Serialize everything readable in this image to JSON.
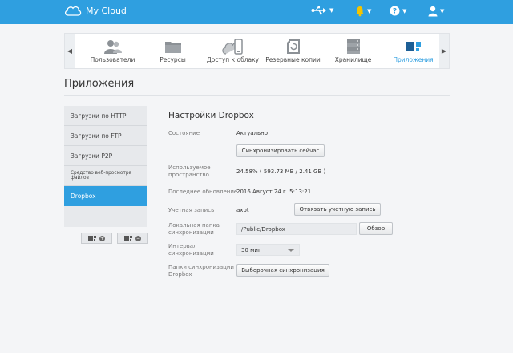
{
  "header": {
    "brand": "My Cloud"
  },
  "nav": {
    "items": [
      {
        "label": "Пользователи"
      },
      {
        "label": "Ресурсы"
      },
      {
        "label": "Доступ к облаку"
      },
      {
        "label": "Резервные копии"
      },
      {
        "label": "Хранилище"
      },
      {
        "label": "Приложения"
      }
    ],
    "active": "Приложения"
  },
  "page": {
    "title": "Приложения"
  },
  "sidebar": {
    "items": [
      {
        "label": "Загрузки по HTTP"
      },
      {
        "label": "Загрузки по FTP"
      },
      {
        "label": "Загрузки P2P"
      },
      {
        "label": "Средство веб-просмотра файлов"
      },
      {
        "label": "Dropbox"
      }
    ],
    "active": "Dropbox"
  },
  "dropbox": {
    "title": "Настройки Dropbox",
    "status_label": "Состояние",
    "status_value": "Актуально",
    "sync_now_button": "Синхронизировать сейчас",
    "used_space_label_1": "Используемое",
    "used_space_label_2": "пространство",
    "used_space_value": "24.58% ( 593.73 MB / 2.41 GB )",
    "last_update_label": "Последнее обновление",
    "last_update_value": "2016 Август 24 г. 5:13:21",
    "account_label": "Учетная запись",
    "account_value": "axbt",
    "unlink_button": "Отвязать учетную запись",
    "local_folder_label_1": "Локальная папка",
    "local_folder_label_2": "синхронизации",
    "local_folder_value": "/Public/Dropbox",
    "browse_button": "Обзор",
    "interval_label_1": "Интервал",
    "interval_label_2": "синхронизации",
    "interval_value": "30 мин",
    "sync_folders_label_1": "Папки синхронизации",
    "sync_folders_label_2": "Dropbox",
    "selective_sync_button": "Выборочная синхронизация"
  },
  "colors": {
    "accent": "#2f9fe0",
    "background": "#f4f5f7"
  }
}
